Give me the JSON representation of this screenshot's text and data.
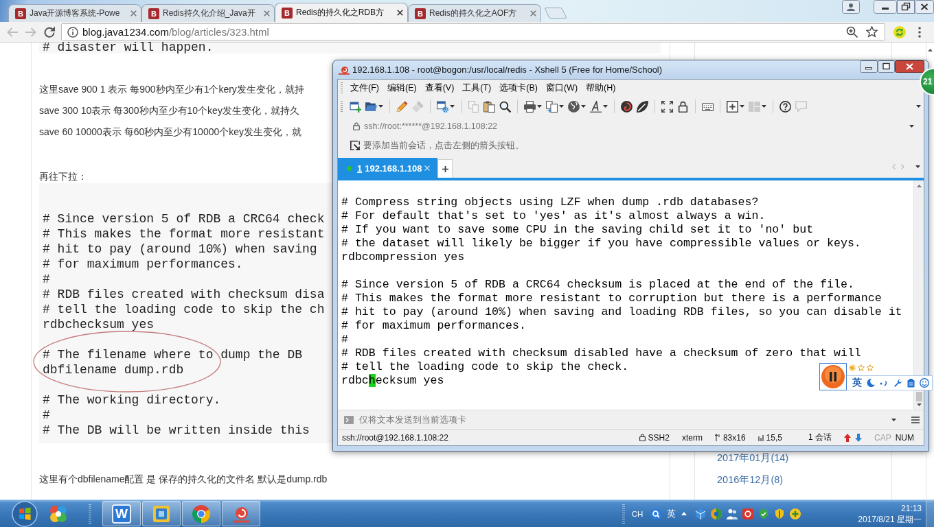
{
  "browser": {
    "tabs": [
      {
        "icon_letter": "B",
        "title": "Java开源博客系统-Powe",
        "selected": false
      },
      {
        "icon_letter": "B",
        "title": "Redis持久化介绍_Java开",
        "selected": false
      },
      {
        "icon_letter": "B",
        "title": "Redis的持久化之RDB方",
        "selected": true
      },
      {
        "icon_letter": "B",
        "title": "Redis的持久化之AOF方",
        "selected": false
      }
    ],
    "nav": [
      {
        "kind": "back",
        "disabled": true
      },
      {
        "kind": "forward",
        "disabled": true
      },
      {
        "kind": "reload",
        "disabled": false
      }
    ],
    "url": {
      "host": "blog.java1234.com",
      "path": "/blog/articles/323.html"
    }
  },
  "article": {
    "blocks": [
      {
        "kind": "code",
        "paragraphs": [
          {
            "lines": [
              "# disaster will happen."
            ],
            "circled": false
          }
        ]
      },
      {
        "kind": "text",
        "text": "这里save 900 1 表示 每900秒内至少有1个kery发生变化，就持"
      },
      {
        "kind": "text",
        "text": "save 300 10表示 每300秒内至少有10个key发生变化，就持久"
      },
      {
        "kind": "text",
        "text": "save 60 10000表示 每60秒内至少有10000个key发生变化，就"
      },
      {
        "kind": "text",
        "text": "再往下拉："
      },
      {
        "kind": "code",
        "paragraphs": [
          {
            "lines": [
              "# Since version 5 of RDB a CRC64 check",
              "# This makes the format more resistant",
              "# hit to pay (around 10%) when saving",
              "# for maximum performances.",
              "#",
              "# RDB files created with checksum disa",
              "# tell the loading code to skip the ch",
              "rdbchecksum yes"
            ],
            "circled": false
          },
          {
            "lines": [
              "# The filename where to dump the DB",
              "dbfilename dump.rdb"
            ],
            "circled": true
          },
          {
            "lines": [
              "# The working directory.",
              "#",
              "# The DB will be written inside this"
            ],
            "circled": false
          }
        ]
      },
      {
        "kind": "text",
        "text": "这里有个dbfilename配置 是 保存的持久化的文件名 默认是dump.rdb"
      }
    ]
  },
  "sidebar": {
    "archive": [
      "2017年01月(14)",
      "2016年12月(8)"
    ]
  },
  "xshell": {
    "title": "192.168.1.108 - root@bogon:/usr/local/redis - Xshell 5 (Free for Home/School)",
    "menu": [
      "文件(F)",
      "编辑(E)",
      "查看(V)",
      "工具(T)",
      "选项卡(B)",
      "窗口(W)",
      "帮助(H)"
    ],
    "toolbar": [
      [
        {
          "kind": "new-session",
          "disabled": false,
          "dropdown": false
        },
        {
          "kind": "open",
          "disabled": false,
          "dropdown": true
        }
      ],
      [
        {
          "kind": "pencil",
          "disabled": false,
          "dropdown": false
        },
        {
          "kind": "brush",
          "disabled": true,
          "dropdown": false
        }
      ],
      [
        {
          "kind": "properties",
          "disabled": false,
          "dropdown": true
        }
      ],
      [
        {
          "kind": "copy",
          "disabled": true,
          "dropdown": false
        },
        {
          "kind": "paste",
          "disabled": false,
          "dropdown": false
        },
        {
          "kind": "find",
          "disabled": false,
          "dropdown": false
        }
      ],
      [
        {
          "kind": "print",
          "disabled": false,
          "dropdown": true
        },
        {
          "kind": "transfer",
          "disabled": false,
          "dropdown": true
        },
        {
          "kind": "globe",
          "disabled": false,
          "dropdown": true
        },
        {
          "kind": "font",
          "disabled": false,
          "dropdown": true
        }
      ],
      [
        {
          "kind": "xftp",
          "disabled": false,
          "dropdown": false
        },
        {
          "kind": "xmanager",
          "disabled": false,
          "dropdown": false
        }
      ],
      [
        {
          "kind": "fullscreen",
          "disabled": false,
          "dropdown": false
        },
        {
          "kind": "lock",
          "disabled": false,
          "dropdown": false
        }
      ],
      [
        {
          "kind": "keyboard",
          "disabled": false,
          "dropdown": false
        }
      ],
      [
        {
          "kind": "add",
          "disabled": false,
          "dropdown": true
        },
        {
          "kind": "layout",
          "disabled": true,
          "dropdown": true
        }
      ],
      [
        {
          "kind": "help",
          "disabled": false,
          "dropdown": false
        },
        {
          "kind": "chat",
          "disabled": true,
          "dropdown": false
        }
      ]
    ],
    "address": "ssh://root:******@192.168.1.108:22",
    "hint": "要添加当前会话，点击左侧的箭头按钮。",
    "tabs": [
      {
        "number": "1",
        "label": "192.168.1.108",
        "selected": true
      }
    ],
    "terminal": {
      "paragraphs": [
        [
          "# Compress string objects using LZF when dump .rdb databases?",
          "# For default that's set to 'yes' as it's almost always a win.",
          "# If you want to save some CPU in the saving child set it to 'no' but",
          "# the dataset will likely be bigger if you have compressible values or keys.",
          "rdbcompression yes"
        ],
        [
          "# Since version 5 of RDB a CRC64 checksum is placed at the end of the file.",
          "# This makes the format more resistant to corruption but there is a performance",
          "# hit to pay (around 10%) when saving and loading RDB files, so you can disable it",
          "# for maximum performances.",
          "#",
          "# RDB files created with checksum disabled have a checksum of zero that will",
          "# tell the loading code to skip the check."
        ]
      ],
      "cursor_line": {
        "before": "rdbc",
        "at_cursor": "h",
        "after": "ecksum yes"
      }
    },
    "compose": {
      "placeholder": "仅将文本发送到当前选项卡"
    },
    "status": {
      "address": "ssh://root@192.168.1.108:22",
      "protocol": "SSH2",
      "terminal_type": "xterm",
      "size": "83x16",
      "cursor": "15,5",
      "sessions": "1 会话",
      "keys": [
        {
          "label": "CAP",
          "on": false
        },
        {
          "label": "NUM",
          "on": true
        }
      ]
    }
  },
  "ime_toolbar": {
    "mode": "英"
  },
  "floating_ball": {
    "text": "21"
  },
  "taskbar": {
    "apps": [
      {
        "kind": "suite",
        "running": false
      },
      {
        "kind": "office",
        "glyph": "W",
        "running": true
      },
      {
        "kind": "vm",
        "running": true
      },
      {
        "kind": "browser",
        "running": true
      },
      {
        "kind": "terminal",
        "running": true
      }
    ],
    "tray": {
      "language": "CH",
      "ime_mode": "英",
      "time": "21:13",
      "date": "2017/8/21 星期一"
    }
  }
}
